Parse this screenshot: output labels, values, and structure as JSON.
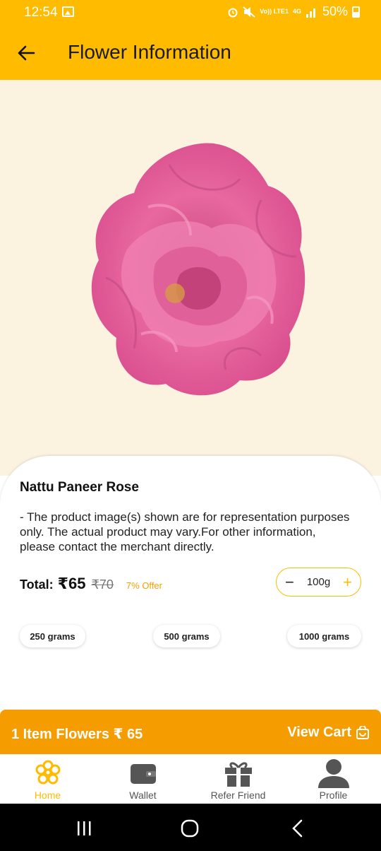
{
  "status_bar": {
    "time": "12:54",
    "battery": "50%",
    "network": "4G",
    "volte": "Vo)) LTE1"
  },
  "app_bar": {
    "title": "Flower Information"
  },
  "product": {
    "name": "Nattu Paneer Rose",
    "description": "- The product image(s) shown are for representation purposes only. The actual product may vary.For other information, please contact the merchant directly.",
    "total_label": "Total:",
    "price": "₹65",
    "old_price": "₹70",
    "offer": "7% Offer",
    "quantity": "100g",
    "gram_options": [
      "250 grams",
      "500 grams",
      "1000 grams"
    ]
  },
  "cart_bar": {
    "summary": "1 Item Flowers ₹ 65",
    "view_cart": "View Cart"
  },
  "bottom_nav": [
    {
      "label": "Home",
      "icon": "flower-icon",
      "active": true
    },
    {
      "label": "Wallet",
      "icon": "wallet-icon",
      "active": false
    },
    {
      "label": "Refer Friend",
      "icon": "gift-icon",
      "active": false
    },
    {
      "label": "Profile",
      "icon": "person-icon",
      "active": false
    }
  ],
  "colors": {
    "primary": "#FFBB00",
    "cart": "#F59C00",
    "hero_bg": "#FBF3E0",
    "rose": "#E0609F"
  }
}
